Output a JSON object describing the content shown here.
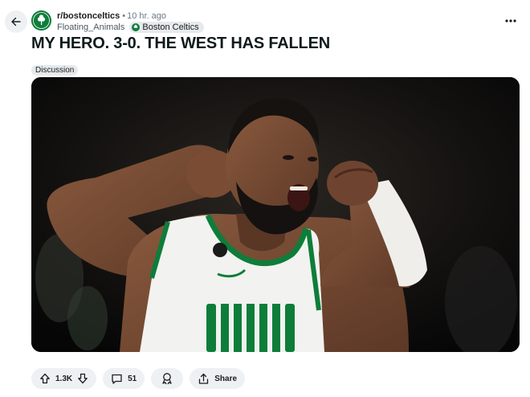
{
  "header": {
    "subreddit": "r/bostonceltics",
    "separator": "•",
    "time_ago": "10 hr. ago",
    "username": "Floating_Animals",
    "user_flair": "Boston Celtics"
  },
  "post": {
    "title": "MY HERO. 3-0. THE WEST HAS FALLEN",
    "tag": "Discussion",
    "image_alt": "Celtics player flexing both arms and shouting in celebration"
  },
  "actions": {
    "upvote_count": "1.3K",
    "comment_count": "51",
    "share_label": "Share"
  },
  "icons": {
    "back": "arrow-left-icon",
    "more": "ellipsis-icon",
    "upvote": "upvote-arrow-icon",
    "downvote": "downvote-arrow-icon",
    "comment": "comment-bubble-icon",
    "award": "award-icon",
    "share": "share-icon"
  },
  "colors": {
    "celtics_green": "#0e7d3a",
    "pill_bg": "#eef1f3",
    "jersey_white": "#f2f2f0"
  }
}
